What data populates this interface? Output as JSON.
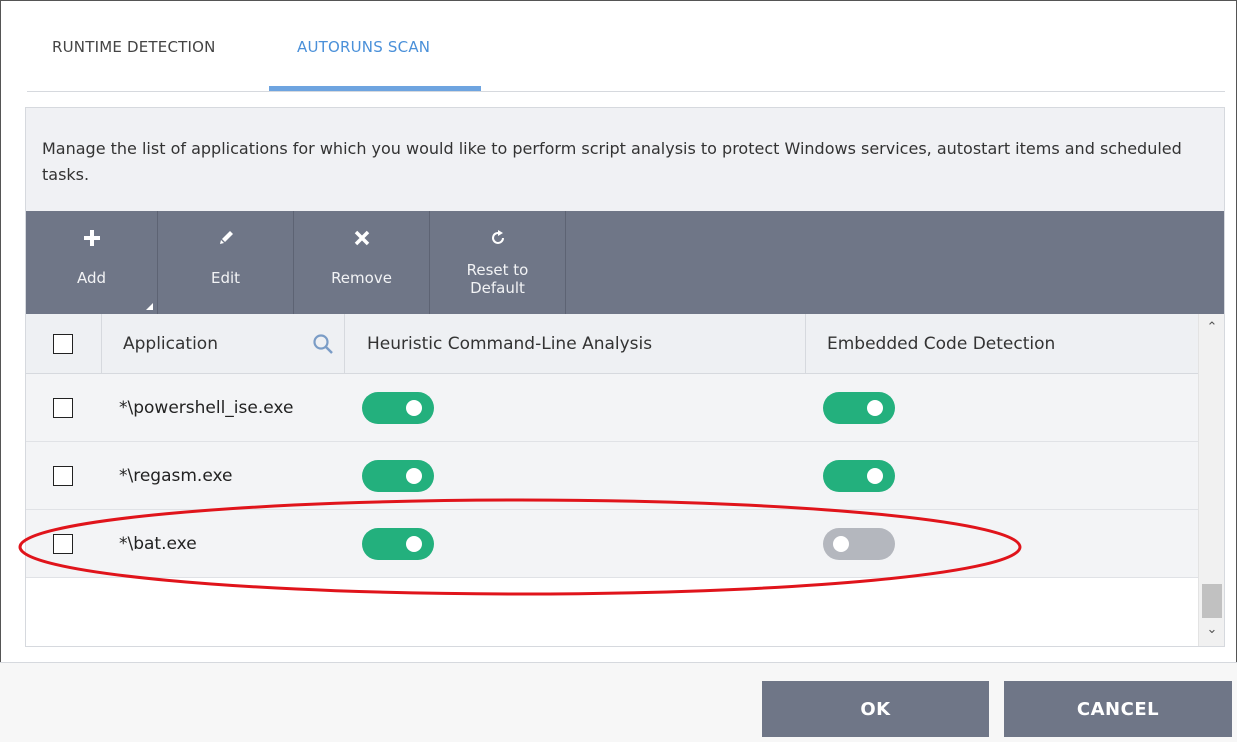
{
  "tabs": [
    {
      "label": "RUNTIME DETECTION",
      "active": false
    },
    {
      "label": "AUTORUNS SCAN",
      "active": true
    }
  ],
  "description": "Manage the list of applications for which you would like to perform script analysis to protect Windows services, autostart items and scheduled tasks.",
  "toolbar": {
    "add_label": "Add",
    "edit_label": "Edit",
    "remove_label": "Remove",
    "reset_label_line1": "Reset to",
    "reset_label_line2": "Default",
    "icons": [
      "plus-icon",
      "pencil-icon",
      "x-icon",
      "refresh-icon"
    ]
  },
  "table": {
    "columns": [
      "Application",
      "Heuristic Command-Line Analysis",
      "Embedded Code Detection"
    ],
    "rows": [
      {
        "application": "*\\powershell_ise.exe",
        "heuristic": true,
        "embedded": true
      },
      {
        "application": "*\\regasm.exe",
        "heuristic": true,
        "embedded": true
      },
      {
        "application": "*\\bat.exe",
        "heuristic": true,
        "embedded": false
      }
    ]
  },
  "buttons": {
    "ok_label": "OK",
    "cancel_label": "CANCEL"
  },
  "colors": {
    "active_tab": "#4a90d9",
    "toolbar_bg": "#6f7687",
    "toggle_on": "#23b07d",
    "toggle_off": "#b4b7be",
    "annotation": "#e0141b"
  }
}
